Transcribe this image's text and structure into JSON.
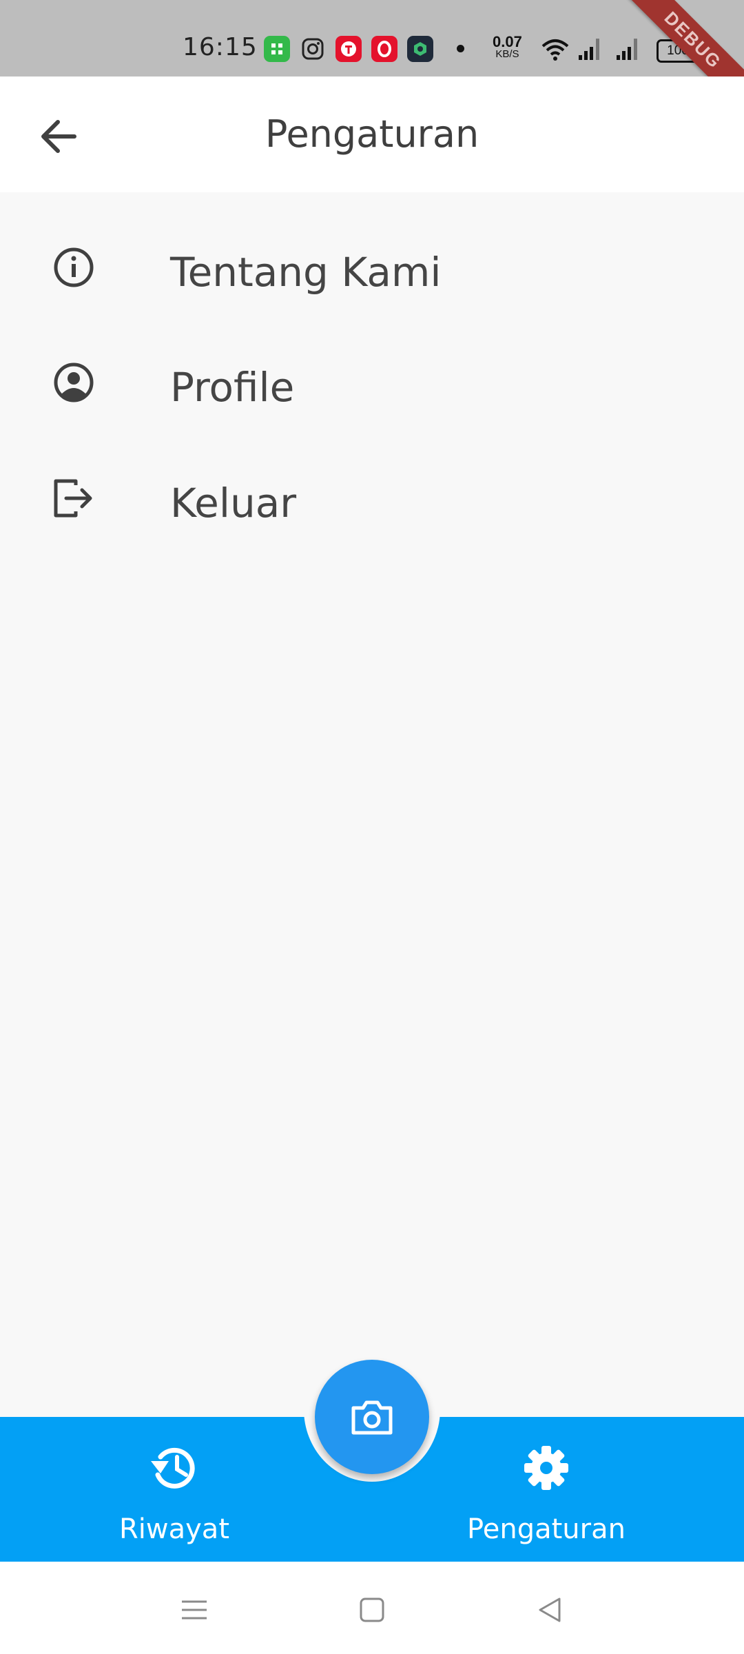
{
  "status_bar": {
    "time": "16:15",
    "network_speed_value": "0.07",
    "network_speed_unit": "KB/S",
    "battery": "100"
  },
  "debug_banner": "DEBUG",
  "app_bar": {
    "title": "Pengaturan",
    "back_icon": "arrow-left-icon"
  },
  "menu": [
    {
      "label": "Tentang Kami",
      "icon": "info-circle-icon"
    },
    {
      "label": "Profile",
      "icon": "account-circle-icon"
    },
    {
      "label": "Keluar",
      "icon": "logout-icon"
    }
  ],
  "bottom_nav": {
    "items": [
      {
        "label": "Riwayat",
        "icon": "history-icon"
      },
      {
        "label": "Pengaturan",
        "icon": "settings-gear-icon"
      }
    ],
    "fab_icon": "camera-icon"
  },
  "colors": {
    "accent": "#03a0f5",
    "fab": "#2396f0",
    "background": "#f8f8f8",
    "status_bar": "#bdbdbd"
  }
}
